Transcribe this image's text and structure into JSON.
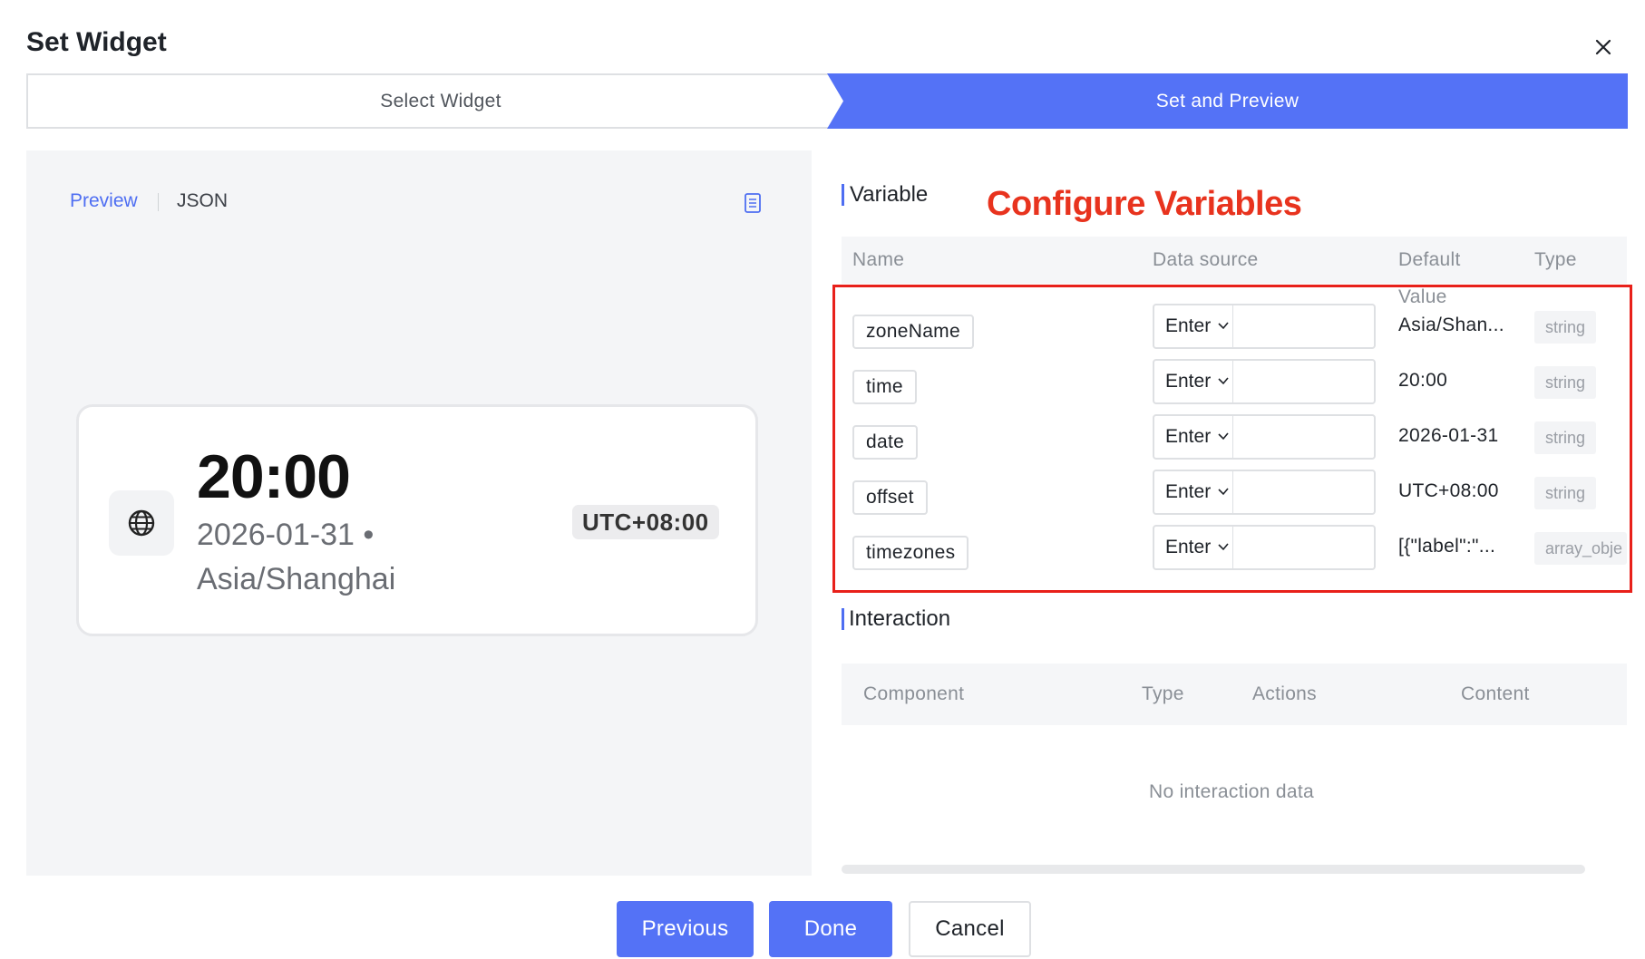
{
  "dialog": {
    "title": "Set Widget"
  },
  "steps": [
    {
      "label": "Select Widget"
    },
    {
      "label": "Set and Preview"
    }
  ],
  "left": {
    "preview_tab": "Preview",
    "json_tab": "JSON",
    "widget": {
      "time": "20:00",
      "date": "2026-01-31 •",
      "zone": "Asia/Shanghai",
      "offset": "UTC+08:00"
    }
  },
  "variable": {
    "title": "Variable",
    "annotation": "Configure Variables",
    "columns": {
      "name": "Name",
      "data_source": "Data source",
      "default": "Default",
      "default_sub": "Value",
      "type": "Type"
    },
    "rows": [
      {
        "name": "zoneName",
        "source": "Enter",
        "default": "Asia/Shan...",
        "type": "string"
      },
      {
        "name": "time",
        "source": "Enter",
        "default": "20:00",
        "type": "string"
      },
      {
        "name": "date",
        "source": "Enter",
        "default": "2026-01-31",
        "type": "string"
      },
      {
        "name": "offset",
        "source": "Enter",
        "default": "UTC+08:00",
        "type": "string"
      },
      {
        "name": "timezones",
        "source": "Enter",
        "default": "[{\"label\":\"...",
        "type": "array_obje"
      }
    ]
  },
  "interaction": {
    "title": "Interaction",
    "columns": {
      "component": "Component",
      "type": "Type",
      "actions": "Actions",
      "content": "Content"
    },
    "empty": "No interaction data"
  },
  "footer": {
    "previous": "Previous",
    "done": "Done",
    "cancel": "Cancel"
  },
  "colors": {
    "accent": "#5472f6",
    "annotation": "#e8331e",
    "highlight_border": "#e8201a"
  }
}
